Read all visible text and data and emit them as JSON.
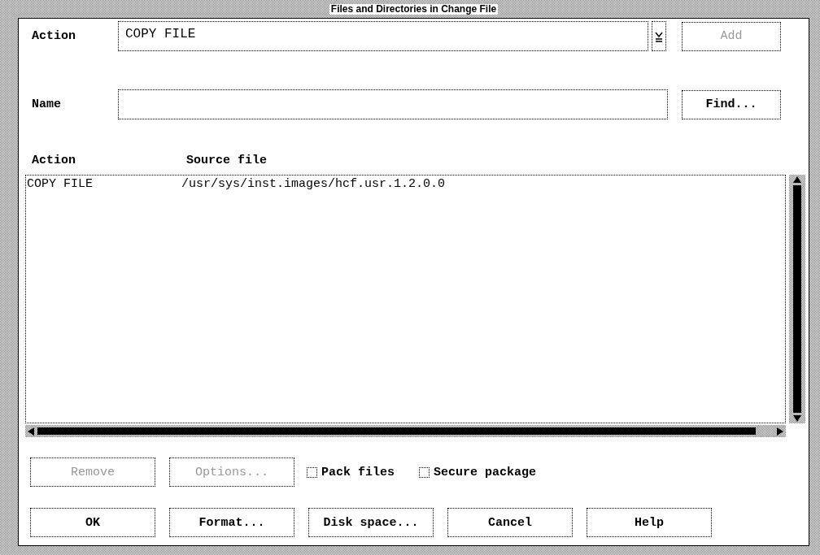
{
  "window": {
    "title": "Files and Directories in Change File"
  },
  "action": {
    "label": "Action",
    "value": "COPY FILE",
    "add_button": {
      "label": "Add",
      "disabled": true
    }
  },
  "name": {
    "label": "Name",
    "find_button": {
      "label": "Find...",
      "disabled": false
    }
  },
  "table": {
    "columns": [
      "Action",
      "Source file"
    ],
    "rows": [
      {
        "action": "COPY FILE",
        "source_file": "/usr/sys/inst.images/hcf.usr.1.2.0.0"
      }
    ]
  },
  "options_row": {
    "buttons": [
      {
        "label": "Remove",
        "disabled": true
      },
      {
        "label": "Options...",
        "disabled": true
      }
    ],
    "checkboxes": [
      {
        "label": "Pack files",
        "checked": false
      },
      {
        "label": "Secure package",
        "checked": false
      }
    ]
  },
  "buttons": [
    {
      "label": "OK",
      "disabled": false
    },
    {
      "label": "Format...",
      "disabled": false
    },
    {
      "label": "Disk space...",
      "disabled": false
    },
    {
      "label": "Cancel",
      "disabled": false
    },
    {
      "label": "Help",
      "disabled": false
    }
  ]
}
